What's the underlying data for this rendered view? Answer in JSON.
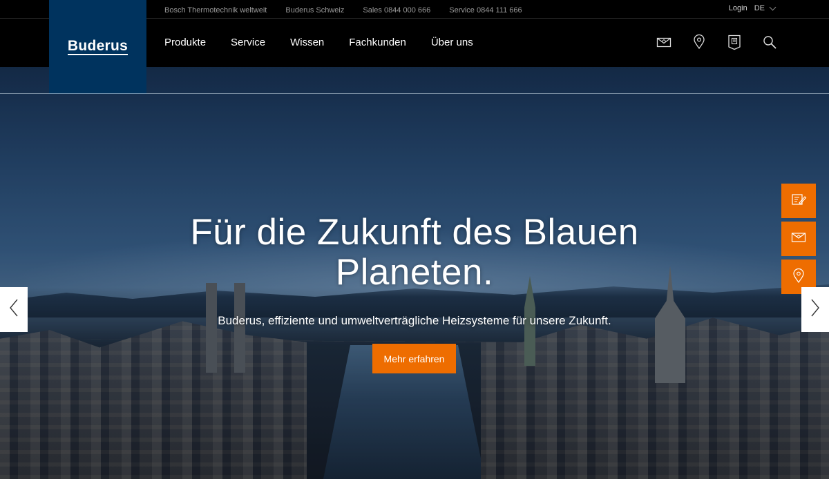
{
  "brand": {
    "logo_text": "Buderus",
    "accent_color": "#ee6d00",
    "logo_bg": "#00335e"
  },
  "topbar": {
    "links": [
      "Bosch Thermotechnik weltweit",
      "Buderus Schweiz",
      "Sales 0844 000 666",
      "Service 0844 111 666"
    ],
    "login_label": "Login",
    "language": "DE"
  },
  "nav": {
    "items": [
      "Produkte",
      "Service",
      "Wissen",
      "Fachkunden",
      "Über uns"
    ],
    "icons": [
      "mail-icon",
      "location-pin-icon",
      "brochure-icon",
      "search-icon"
    ]
  },
  "hero": {
    "headline": "Für die Zukunft des Blauen Planeten.",
    "subline": "Buderus, effiziente und umweltverträgliche Heizsysteme für unsere Zukunft.",
    "cta_label": "Mehr erfahren"
  },
  "side_buttons": [
    "contact-form-icon",
    "mail-icon",
    "location-pin-icon"
  ],
  "carousel": {
    "prev": "chevron-left-icon",
    "next": "chevron-right-icon"
  }
}
